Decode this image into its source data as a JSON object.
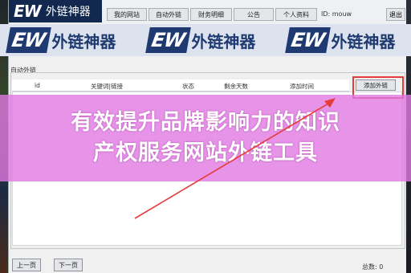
{
  "logo": {
    "mark": "EW",
    "name": "外链神器"
  },
  "menu": {
    "items": [
      "我的网站",
      "自动外链",
      "财务明细",
      "公告",
      "个人资料"
    ],
    "id_label": "ID: mouw",
    "exit_label": "退出"
  },
  "banner": {
    "mark": "EW",
    "name": "外链神器"
  },
  "group": {
    "title": "自动外链"
  },
  "table": {
    "columns": [
      "id",
      "关键词|链接",
      "状态",
      "剩余天数",
      "添加时间"
    ],
    "rows": []
  },
  "add_button": {
    "label": "添加外链"
  },
  "headline": {
    "line1": "有效提升品牌影响力的知识",
    "line2": "产权服务网站外链工具"
  },
  "footer": {
    "prev_label": "上一页",
    "next_label": "下一页",
    "total": "总数: 0"
  },
  "colors": {
    "highlight": "#e53b3b",
    "headline_bg": "#e078e2",
    "logo_bg": "#13284f"
  }
}
